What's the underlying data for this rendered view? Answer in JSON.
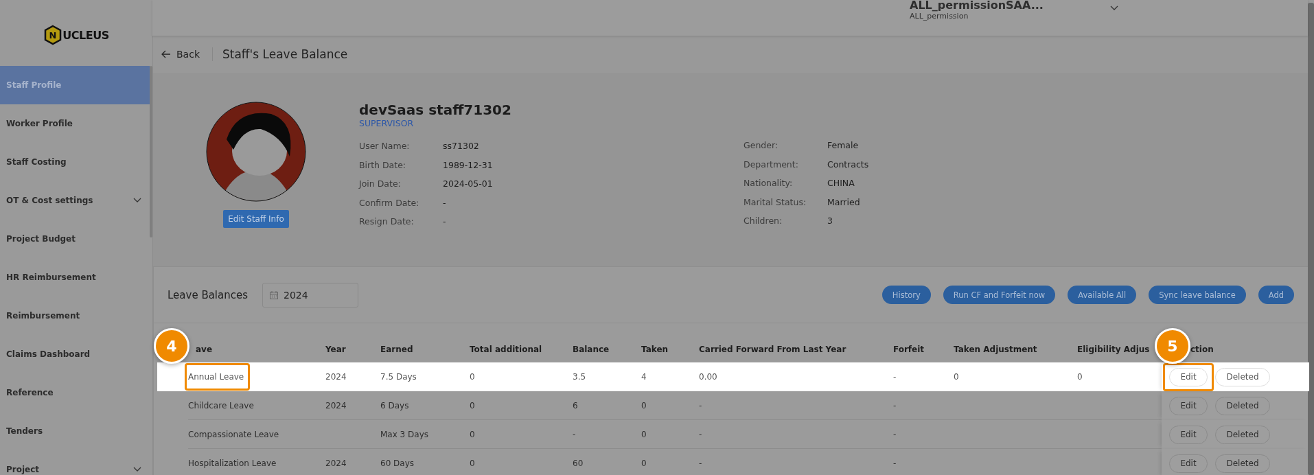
{
  "logo": {
    "initial": "N",
    "rest": "UCLEUS"
  },
  "user": {
    "name": "ALL_permissionSAA...",
    "role": "ALL_permission"
  },
  "sidebar": {
    "items": [
      {
        "label": "Staff Profile",
        "selected": true,
        "expandable": false
      },
      {
        "label": "Worker Profile",
        "selected": false,
        "expandable": false
      },
      {
        "label": "Staff Costing",
        "selected": false,
        "expandable": false
      },
      {
        "label": "OT & Cost settings",
        "selected": false,
        "expandable": true
      },
      {
        "label": "Project Budget",
        "selected": false,
        "expandable": false
      },
      {
        "label": "HR Reimbursement",
        "selected": false,
        "expandable": false
      },
      {
        "label": "Reimbursement",
        "selected": false,
        "expandable": false
      },
      {
        "label": "Claims Dashboard",
        "selected": false,
        "expandable": false
      },
      {
        "label": "Reference",
        "selected": false,
        "expandable": false
      },
      {
        "label": "Tenders",
        "selected": false,
        "expandable": false
      },
      {
        "label": "Project",
        "selected": false,
        "expandable": true
      }
    ]
  },
  "header": {
    "back": "Back",
    "title": "Staff's Leave Balance"
  },
  "profile": {
    "name": "devSaas staff71302",
    "position": "SUPERVISOR",
    "edit_button": "Edit Staff Info",
    "left_fields": [
      {
        "label": "User Name:",
        "value": "ss71302"
      },
      {
        "label": "Birth Date:",
        "value": "1989-12-31"
      },
      {
        "label": "Join Date:",
        "value": "2024-05-01"
      },
      {
        "label": "Confirm Date:",
        "value": "-"
      },
      {
        "label": "Resign Date:",
        "value": "-"
      }
    ],
    "right_fields": [
      {
        "label": "Gender:",
        "value": "Female"
      },
      {
        "label": "Department:",
        "value": "Contracts"
      },
      {
        "label": "Nationality:",
        "value": "CHINA"
      },
      {
        "label": "Marital Status:",
        "value": "Married"
      },
      {
        "label": "Children:",
        "value": "3"
      }
    ]
  },
  "leave_balances": {
    "title": "Leave Balances",
    "year": "2024",
    "buttons": [
      "History",
      "Run CF and Forfeit now",
      "Available All",
      "Sync leave balance",
      "Add"
    ],
    "columns": [
      {
        "label": "ave",
        "callout": "4"
      },
      {
        "label": "Year"
      },
      {
        "label": "Earned"
      },
      {
        "label": "Total additional"
      },
      {
        "label": "Balance"
      },
      {
        "label": "Taken"
      },
      {
        "label": "Carried Forward From Last Year"
      },
      {
        "label": "Forfeit"
      },
      {
        "label": "Taken Adjustment"
      },
      {
        "label": "Eligibility Adjus"
      },
      {
        "label": "ction",
        "callout": "5"
      }
    ],
    "rows": [
      {
        "cells": [
          "Annual Leave",
          "2024",
          "7.5 Days",
          "0",
          "3.5",
          "4",
          "0.00",
          "-",
          "0",
          "0"
        ],
        "actions": [
          "Edit",
          "Deleted"
        ],
        "highlighted": true,
        "leave_outlined": true,
        "edit_outlined": true
      },
      {
        "cells": [
          "Childcare Leave",
          "2024",
          "6 Days",
          "0",
          "6",
          "0",
          "-",
          "-",
          null,
          null
        ],
        "actions": [
          "Edit",
          "Deleted"
        ],
        "highlighted": false,
        "leave_outlined": false,
        "edit_outlined": false
      },
      {
        "cells": [
          "Compassionate Leave",
          null,
          "Max 3 Days",
          "0",
          "-",
          "0",
          "-",
          "-",
          null,
          null
        ],
        "actions": [
          "Edit",
          "Deleted"
        ],
        "highlighted": false,
        "leave_outlined": false,
        "edit_outlined": false
      },
      {
        "cells": [
          "Hospitalization Leave",
          "2024",
          "60 Days",
          "0",
          "60",
          "0",
          "-",
          "-",
          null,
          null
        ],
        "actions": [
          "Edit",
          "Deleted"
        ],
        "highlighted": false,
        "leave_outlined": false,
        "edit_outlined": false
      }
    ]
  }
}
